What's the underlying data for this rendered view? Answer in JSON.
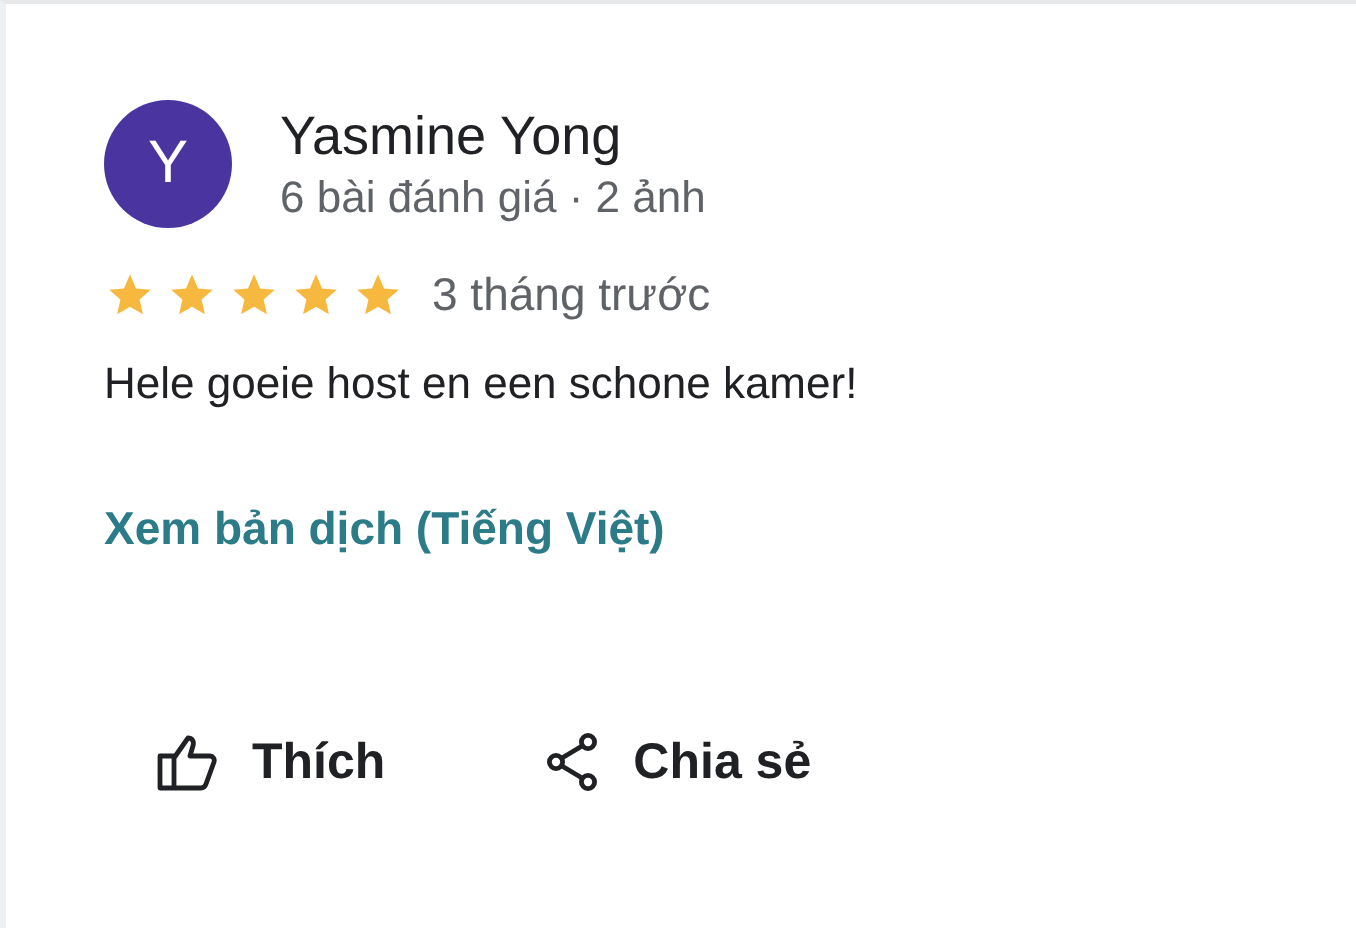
{
  "review": {
    "avatar_letter": "Y",
    "author": "Yasmine Yong",
    "meta": "6 bài đánh giá · 2 ảnh",
    "stars": 5,
    "time": "3 tháng trước",
    "text": "Hele goeie host en een schone kamer!",
    "translate_link": "Xem bản dịch (Tiếng Việt)"
  },
  "actions": [
    {
      "kind": "like",
      "label": "Thích"
    },
    {
      "kind": "share",
      "label": "Chia sẻ"
    }
  ]
}
